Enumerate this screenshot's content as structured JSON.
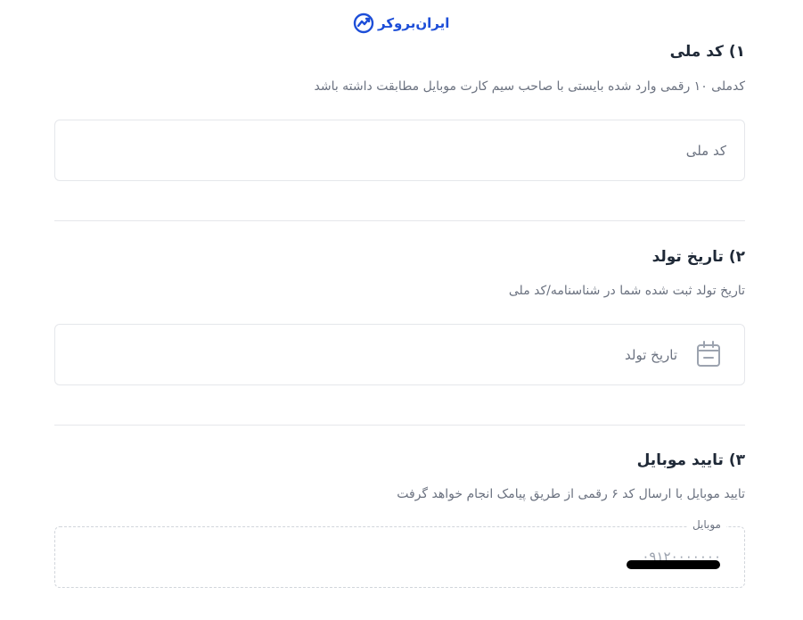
{
  "brand": {
    "name": "ایران‌بروکر",
    "accent_color": "#1d4ed8",
    "logo_icon": "chart-trend-icon"
  },
  "sections": [
    {
      "title": "۱) کد ملی",
      "hint": "کدملی ۱۰ رقمی وارد شده بایستی با صاحب سیم کارت موبایل مطابقت داشته باشد",
      "field": {
        "placeholder": "کد ملی",
        "value": ""
      }
    },
    {
      "title": "۲) تاریخ تولد",
      "hint": "تاریخ تولد ثبت شده شما در شناسنامه/کد ملی",
      "field": {
        "placeholder": "تاریخ تولد",
        "value": "",
        "icon": "calendar-icon"
      }
    },
    {
      "title": "۳) تایید موبایل",
      "hint": "تایید موبایل با ارسال کد ۶ رقمی از طریق پیامک انجام خواهد گرفت",
      "field": {
        "label": "موبایل",
        "value": "۰۹۱۲۰۰۰۰۰۰۰",
        "disabled": true
      }
    }
  ]
}
